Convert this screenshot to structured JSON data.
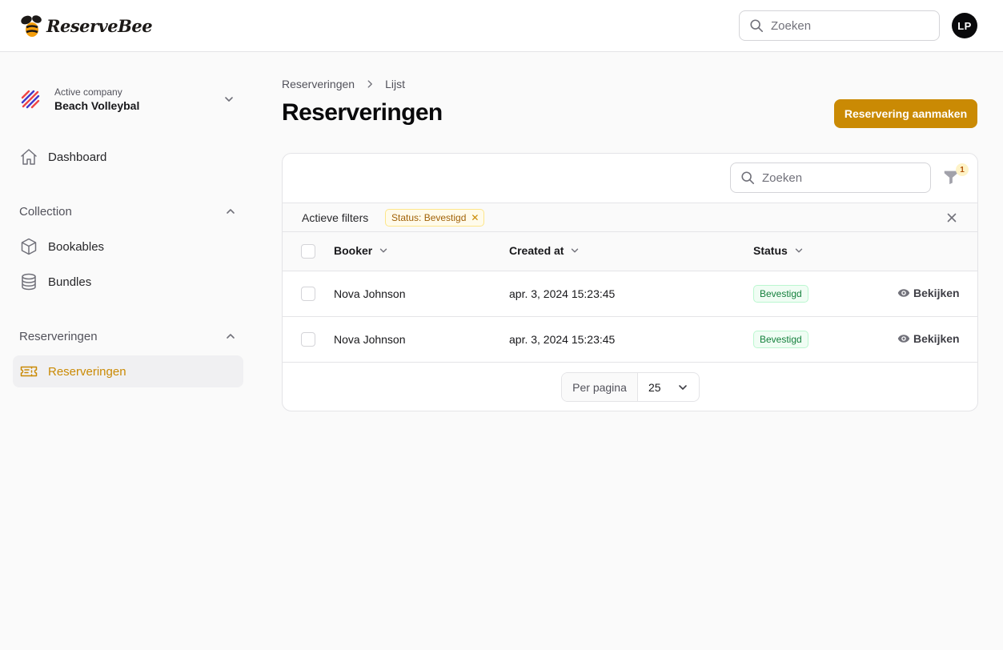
{
  "brand": {
    "name": "ReserveBee",
    "accent": "#ca8a04"
  },
  "header": {
    "search": {
      "placeholder": "Zoeken",
      "value": ""
    },
    "avatar_initials": "LP"
  },
  "sidebar": {
    "company": {
      "label": "Active company",
      "name": "Beach Volleybal"
    },
    "dashboard": {
      "label": "Dashboard",
      "icon": "home-icon"
    },
    "groups": [
      {
        "title": "Collection",
        "items": [
          {
            "label": "Bookables",
            "icon": "cube-icon"
          },
          {
            "label": "Bundles",
            "icon": "database-icon"
          }
        ]
      },
      {
        "title": "Reserveringen",
        "items": [
          {
            "label": "Reserveringen",
            "icon": "ticket-icon",
            "active": true
          }
        ]
      }
    ]
  },
  "main": {
    "breadcrumb": [
      "Reserveringen",
      "Lijst"
    ],
    "title": "Reserveringen",
    "create_button": "Reservering aanmaken",
    "table": {
      "search_placeholder": "Zoeken",
      "filter_count": "1",
      "active_filters_label": "Actieve filters",
      "filter_chip": "Status: Bevestigd",
      "columns": [
        "Booker",
        "Created at",
        "Status"
      ],
      "rows": [
        {
          "booker": "Nova Johnson",
          "created_at": "apr. 3, 2024 15:23:45",
          "status": "Bevestigd",
          "action": "Bekijken"
        },
        {
          "booker": "Nova Johnson",
          "created_at": "apr. 3, 2024 15:23:45",
          "status": "Bevestigd",
          "action": "Bekijken"
        }
      ],
      "pagination": {
        "per_page_label": "Per pagina",
        "per_page_value": "25"
      }
    }
  }
}
